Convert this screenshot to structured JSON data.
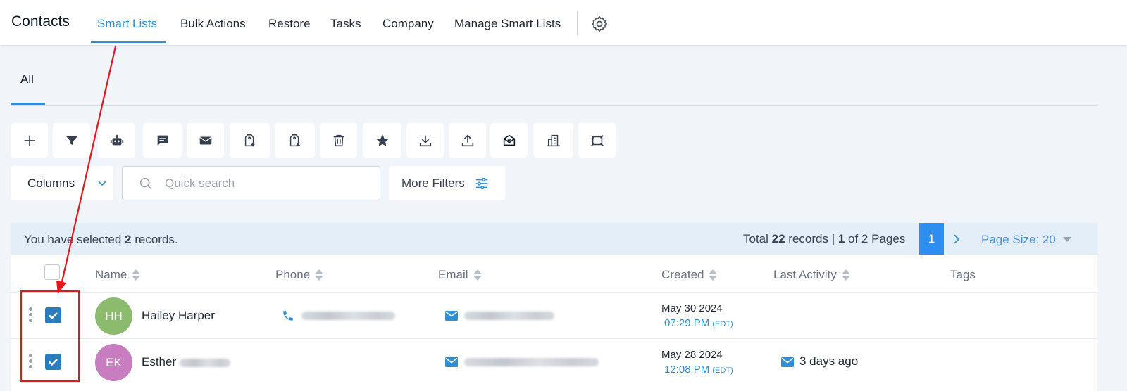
{
  "app": {
    "title": "Contacts"
  },
  "nav": {
    "items": [
      {
        "label": "Smart Lists",
        "active": true
      },
      {
        "label": "Bulk Actions"
      },
      {
        "label": "Restore"
      },
      {
        "label": "Tasks"
      },
      {
        "label": "Company"
      },
      {
        "label": "Manage Smart Lists"
      }
    ],
    "settings_icon": "gear-icon"
  },
  "tabs": [
    {
      "label": "All",
      "active": true
    }
  ],
  "toolbar": [
    "plus-icon",
    "filter-icon",
    "robot-icon",
    "message-icon",
    "envelope-icon",
    "add-tag-icon",
    "remove-tag-icon",
    "trash-icon",
    "star-icon",
    "download-icon",
    "upload-icon",
    "email-verify-icon",
    "company-icon",
    "merge-icon"
  ],
  "filters": {
    "columns_label": "Columns",
    "search_placeholder": "Quick search",
    "more_filters_label": "More Filters"
  },
  "selection": {
    "prefix": "You have selected ",
    "count": "2",
    "suffix": " records."
  },
  "pagination": {
    "total_prefix": "Total ",
    "total": "22",
    "records_sep": " records | ",
    "current": "1",
    "of": " of 2 Pages",
    "page_button": "1",
    "page_size": "Page Size: 20"
  },
  "table": {
    "columns": [
      "Name",
      "Phone",
      "Email",
      "Created",
      "Last Activity",
      "Tags"
    ],
    "rows": [
      {
        "initials": "HH",
        "avatar_color": "#8dbb6d",
        "name": "Hailey Harper",
        "checked": true,
        "created_date": "May 30 2024",
        "created_time": "07:29 PM",
        "tz": "(EDT)",
        "last_activity": ""
      },
      {
        "initials": "EK",
        "avatar_color": "#c77dbf",
        "name": "Esther",
        "checked": true,
        "created_date": "May 28 2024",
        "created_time": "12:08 PM",
        "tz": "(EDT)",
        "last_activity": "3 days ago"
      }
    ]
  },
  "colors": {
    "accent": "#2f8fd6",
    "page_button": "#2e8ef0",
    "checkbox": "#2b7bbf",
    "annotation": "#e3161b",
    "selection_bar": "#e4eef9"
  }
}
